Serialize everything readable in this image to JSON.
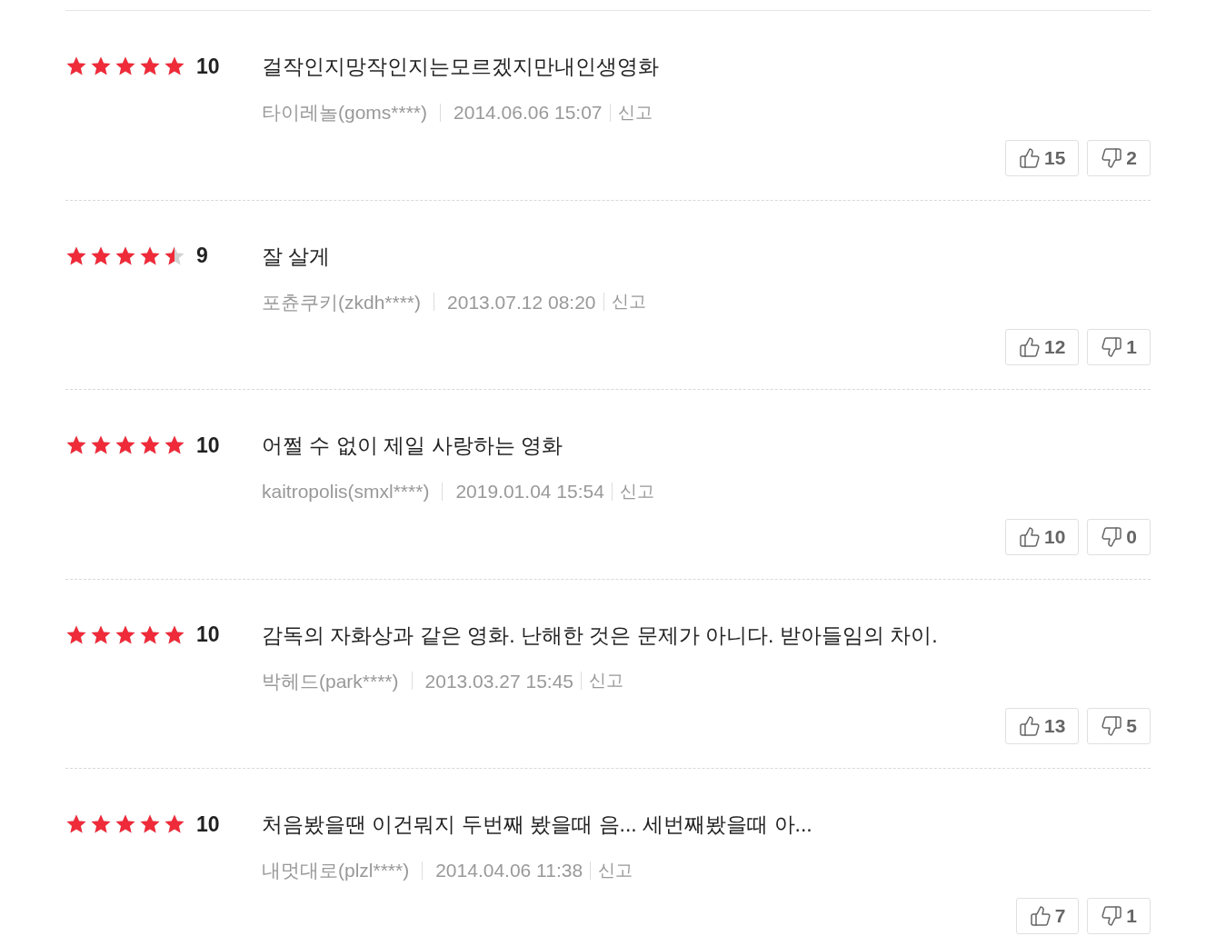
{
  "reviews": [
    {
      "stars": 5,
      "score": "10",
      "text": "걸작인지망작인지는모르겠지만내인생영화",
      "author": "타이레놀(goms****)",
      "date": "2014.06.06 15:07",
      "report": "신고",
      "likes": "15",
      "dislikes": "2"
    },
    {
      "stars": 4.5,
      "score": "9",
      "text": "잘 살게",
      "author": "포츈쿠키(zkdh****)",
      "date": "2013.07.12 08:20",
      "report": "신고",
      "likes": "12",
      "dislikes": "1"
    },
    {
      "stars": 5,
      "score": "10",
      "text": "어쩔 수 없이 제일 사랑하는 영화",
      "author": "kaitropolis(smxl****)",
      "date": "2019.01.04 15:54",
      "report": "신고",
      "likes": "10",
      "dislikes": "0"
    },
    {
      "stars": 5,
      "score": "10",
      "text": "감독의 자화상과 같은 영화. 난해한 것은 문제가 아니다. 받아들임의 차이.",
      "author": "박헤드(park****)",
      "date": "2013.03.27 15:45",
      "report": "신고",
      "likes": "13",
      "dislikes": "5"
    },
    {
      "stars": 5,
      "score": "10",
      "text": "처음봤을땐 이건뭐지 두번째 봤을때 음... 세번째봤을때 아...",
      "author": "내멋대로(plzl****)",
      "date": "2014.04.06 11:38",
      "report": "신고",
      "likes": "7",
      "dislikes": "1"
    }
  ]
}
